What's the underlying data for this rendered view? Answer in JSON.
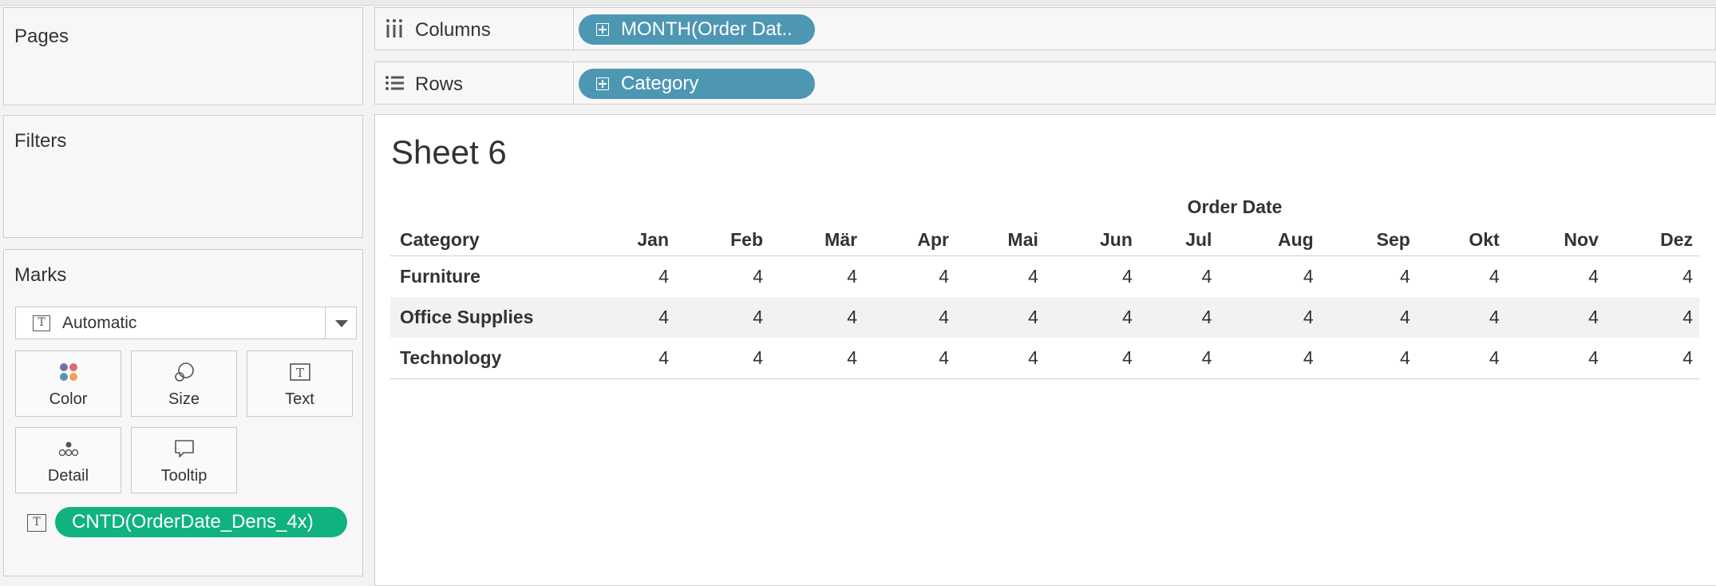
{
  "left_panels": {
    "pages": {
      "title": "Pages"
    },
    "filters": {
      "title": "Filters"
    },
    "marks": {
      "title": "Marks",
      "type_dropdown": "Automatic",
      "buttons": [
        {
          "label": "Color",
          "icon": "color-icon"
        },
        {
          "label": "Size",
          "icon": "size-icon"
        },
        {
          "label": "Text",
          "icon": "text-icon"
        },
        {
          "label": "Detail",
          "icon": "detail-icon"
        },
        {
          "label": "Tooltip",
          "icon": "tooltip-icon"
        }
      ],
      "field_pill": "CNTD(OrderDate_Dens_4x)"
    }
  },
  "shelves": {
    "columns": {
      "label": "Columns",
      "pill": "MONTH(Order Dat.."
    },
    "rows": {
      "label": "Rows",
      "pill": "Category"
    }
  },
  "view": {
    "sheet_title": "Sheet 6",
    "column_group_header": "Order Date",
    "row_header": "Category",
    "months": [
      "Jan",
      "Feb",
      "Mär",
      "Apr",
      "Mai",
      "Jun",
      "Jul",
      "Aug",
      "Sep",
      "Okt",
      "Nov",
      "Dez"
    ],
    "rows": [
      {
        "category": "Furniture",
        "values": [
          "4",
          "4",
          "4",
          "4",
          "4",
          "4",
          "4",
          "4",
          "4",
          "4",
          "4",
          "4"
        ]
      },
      {
        "category": "Office Supplies",
        "values": [
          "4",
          "4",
          "4",
          "4",
          "4",
          "4",
          "4",
          "4",
          "4",
          "4",
          "4",
          "4"
        ]
      },
      {
        "category": "Technology",
        "values": [
          "4",
          "4",
          "4",
          "4",
          "4",
          "4",
          "4",
          "4",
          "4",
          "4",
          "4",
          "4"
        ]
      }
    ]
  },
  "colors": {
    "dimension_pill": "#4e97b3",
    "measure_pill": "#10b27f",
    "color_dots": [
      "#7b6ea8",
      "#e06b6b",
      "#4e97b3",
      "#f2a05a"
    ]
  }
}
